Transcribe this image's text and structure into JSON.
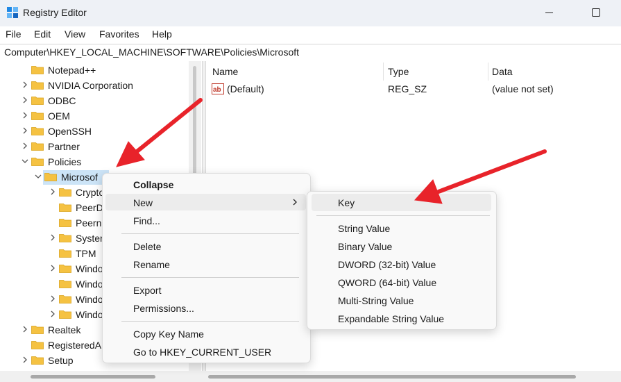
{
  "window": {
    "title": "Registry Editor"
  },
  "menubar": {
    "items": [
      "File",
      "Edit",
      "View",
      "Favorites",
      "Help"
    ]
  },
  "address": {
    "path": "Computer\\HKEY_LOCAL_MACHINE\\SOFTWARE\\Policies\\Microsoft"
  },
  "tree": {
    "items": [
      {
        "label": "Notepad++",
        "expander": "none"
      },
      {
        "label": "NVIDIA Corporation",
        "expander": "collapsed"
      },
      {
        "label": "ODBC",
        "expander": "collapsed"
      },
      {
        "label": "OEM",
        "expander": "collapsed"
      },
      {
        "label": "OpenSSH",
        "expander": "collapsed"
      },
      {
        "label": "Partner",
        "expander": "collapsed"
      },
      {
        "label": "Policies",
        "expander": "expanded"
      },
      {
        "label": "Microsof",
        "expander": "expanded",
        "selected": true
      },
      {
        "label": "Crypto",
        "expander": "collapsed"
      },
      {
        "label": "PeerD",
        "expander": "none"
      },
      {
        "label": "Peern",
        "expander": "none"
      },
      {
        "label": "Syster",
        "expander": "collapsed"
      },
      {
        "label": "TPM",
        "expander": "none"
      },
      {
        "label": "Windo",
        "expander": "collapsed"
      },
      {
        "label": "Windo",
        "expander": "none"
      },
      {
        "label": "Windo",
        "expander": "collapsed"
      },
      {
        "label": "Windo",
        "expander": "collapsed"
      },
      {
        "label": "Realtek",
        "expander": "collapsed"
      },
      {
        "label": "RegisteredA",
        "expander": "none"
      },
      {
        "label": "Setup",
        "expander": "collapsed"
      }
    ]
  },
  "values": {
    "columns": [
      "Name",
      "Type",
      "Data"
    ],
    "rows": [
      {
        "name": "(Default)",
        "type": "REG_SZ",
        "data": "(value not set)",
        "icon": "string-value-icon"
      }
    ]
  },
  "context_menu": {
    "items": [
      "Collapse",
      "New",
      "Find...",
      "Delete",
      "Rename",
      "Export",
      "Permissions...",
      "Copy Key Name",
      "Go to HKEY_CURRENT_USER"
    ]
  },
  "submenu": {
    "items": [
      "Key",
      "String Value",
      "Binary Value",
      "DWORD (32-bit) Value",
      "QWORD (64-bit) Value",
      "Multi-String Value",
      "Expandable String Value"
    ]
  },
  "colors": {
    "selection": "#cce4f7",
    "folder": "#f5c242",
    "annotation_arrow": "#e8232a",
    "hover": "#ececec"
  }
}
